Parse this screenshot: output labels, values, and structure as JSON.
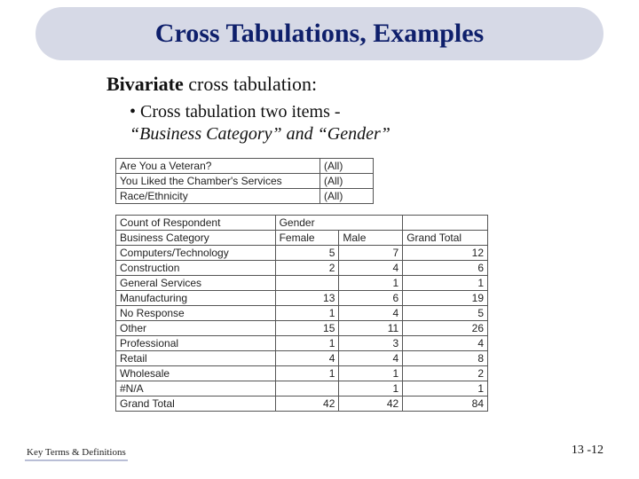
{
  "title": "Cross Tabulations, Examples",
  "subhead_bold": "Bivariate",
  "subhead_rest": " cross tabulation:",
  "bullet_line1": "• Cross tabulation two items -",
  "bullet_line2": "“Business Category” and “Gender”",
  "filters": [
    {
      "label": "Are You a Veteran?",
      "value": "(All)"
    },
    {
      "label": "You Liked the Chamber's Services",
      "value": "(All)"
    },
    {
      "label": "Race/Ethnicity",
      "value": "(All)"
    }
  ],
  "table": {
    "count_label": "Count of Respondent",
    "col_header": "Gender",
    "row_header": "Business Category",
    "cols": [
      "Female",
      "Male"
    ],
    "grand_total_label": "Grand Total",
    "rows": [
      {
        "cat": "Computers/Technology",
        "f": 5,
        "m": 7,
        "t": 12
      },
      {
        "cat": "Construction",
        "f": 2,
        "m": 4,
        "t": 6
      },
      {
        "cat": "General Services",
        "f": "",
        "m": 1,
        "t": 1
      },
      {
        "cat": "Manufacturing",
        "f": 13,
        "m": 6,
        "t": 19
      },
      {
        "cat": "No Response",
        "f": 1,
        "m": 4,
        "t": 5
      },
      {
        "cat": "Other",
        "f": 15,
        "m": 11,
        "t": 26
      },
      {
        "cat": "Professional",
        "f": 1,
        "m": 3,
        "t": 4
      },
      {
        "cat": "Retail",
        "f": 4,
        "m": 4,
        "t": 8
      },
      {
        "cat": "Wholesale",
        "f": 1,
        "m": 1,
        "t": 2
      },
      {
        "cat": "#N/A",
        "f": "",
        "m": 1,
        "t": 1
      }
    ],
    "grand": {
      "f": 42,
      "m": 42,
      "t": 84
    }
  },
  "footer_left": "Key Terms & Definitions",
  "footer_right": "13 -12"
}
